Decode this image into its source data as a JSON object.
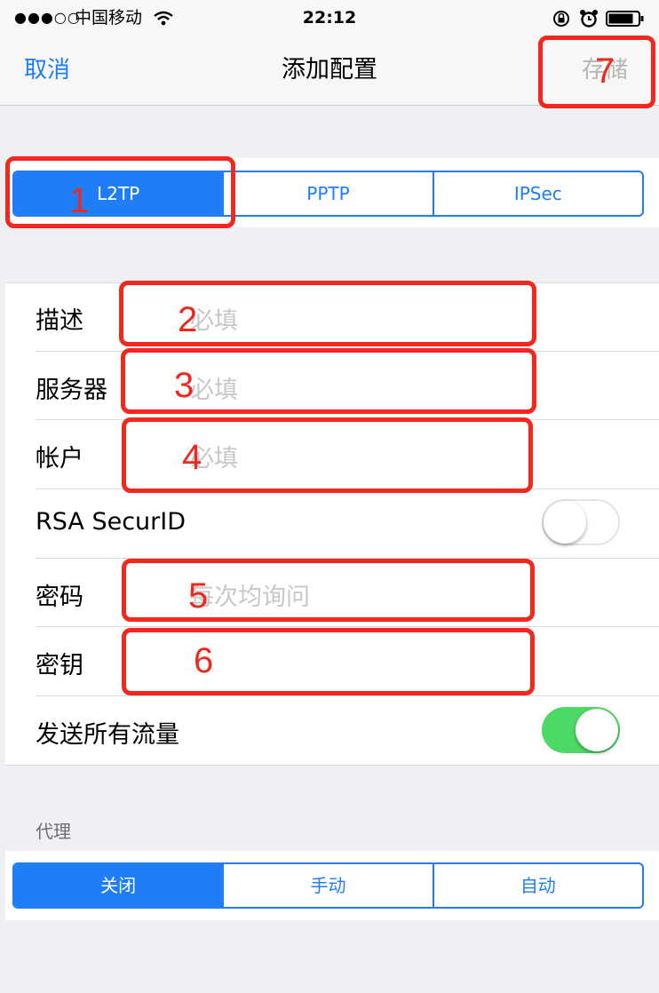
{
  "status_bar": {
    "signal": "●●●○○",
    "carrier": "中国移动",
    "time": "22:12"
  },
  "nav": {
    "cancel": "取消",
    "title": "添加配置",
    "save": "存储"
  },
  "vpn_type": {
    "options": [
      "L2TP",
      "PPTP",
      "IPSec"
    ],
    "selected": "L2TP"
  },
  "form": {
    "description": {
      "label": "描述",
      "placeholder": "必填"
    },
    "server": {
      "label": "服务器",
      "placeholder": "必填"
    },
    "account": {
      "label": "帐户",
      "placeholder": "必填"
    },
    "rsa": {
      "label": "RSA SecurID",
      "on": false
    },
    "password": {
      "label": "密码",
      "placeholder": "每次均询问"
    },
    "secret": {
      "label": "密钥",
      "placeholder": ""
    },
    "send_all_traffic": {
      "label": "发送所有流量",
      "on": true
    }
  },
  "proxy": {
    "header": "代理",
    "options": [
      "关闭",
      "手动",
      "自动"
    ],
    "selected": "关闭"
  },
  "annotations": [
    "1",
    "2",
    "3",
    "4",
    "5",
    "6",
    "7"
  ],
  "colors": {
    "accent": "#1f7ef5",
    "annotation": "#f0281d",
    "toggle_on": "#4cd964"
  }
}
